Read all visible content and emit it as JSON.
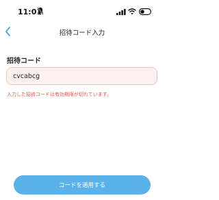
{
  "status_bar": {
    "time": "11:01",
    "icons": [
      "bell-slash-icon",
      "signal-icon",
      "wifi-icon",
      "toggle-icon"
    ]
  },
  "nav": {
    "title": "招待コード入力",
    "back_icon": "chevron-left-icon"
  },
  "form": {
    "label": "招待コード",
    "code_value": "cvcabcg",
    "error_message": "入力した招待コードは有効期限が切れています。"
  },
  "actions": {
    "apply_label": "コードを適用する"
  },
  "colors": {
    "accent": "#5bb1ea",
    "back_icon": "#4aa6e3",
    "error": "#e0584a",
    "input_bg": "#fdf1ee",
    "input_border": "#f3c7bf"
  }
}
